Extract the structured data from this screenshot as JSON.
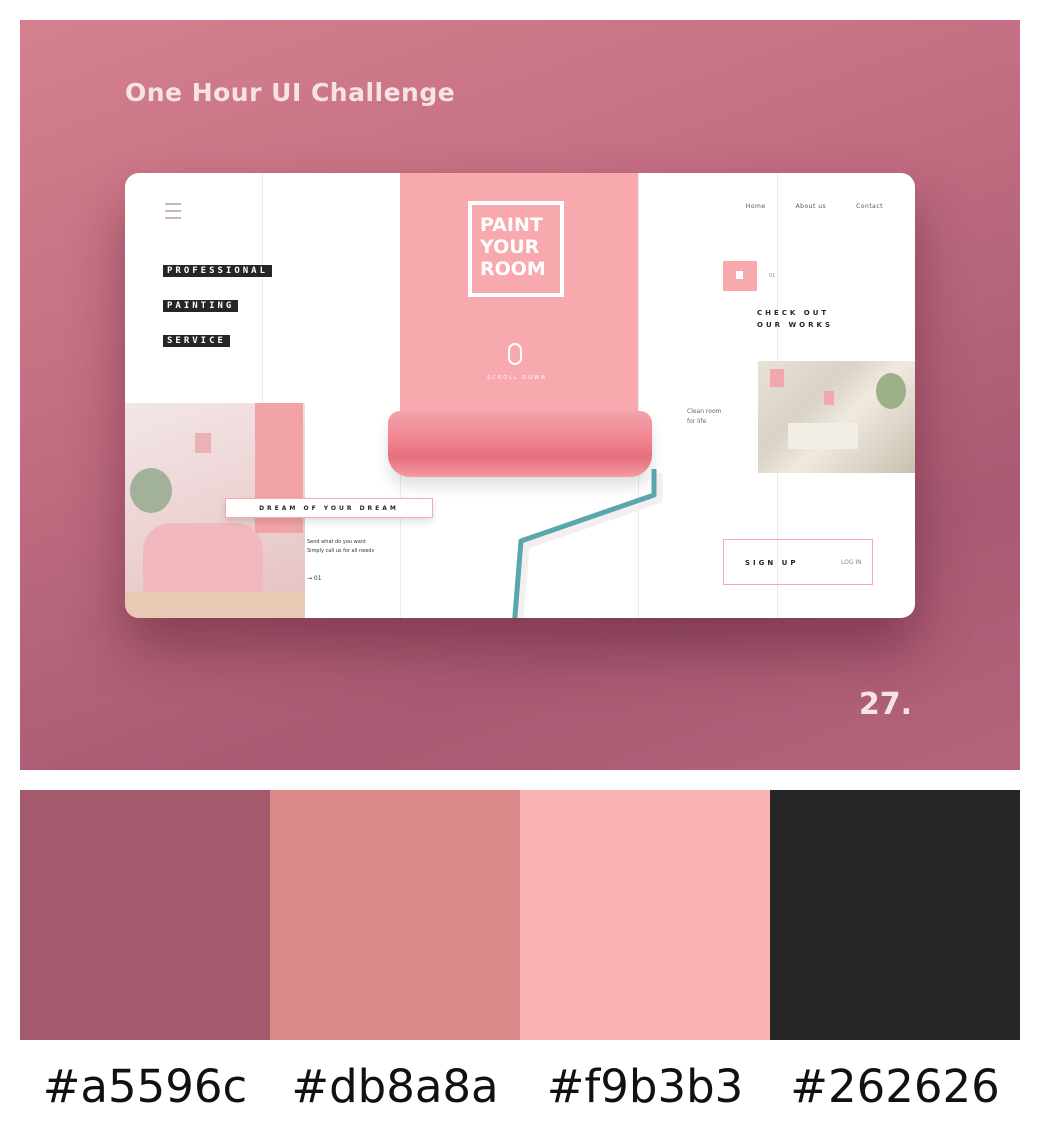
{
  "hero": {
    "title": "One Hour UI Challenge",
    "number": "27."
  },
  "mockup": {
    "headline_lines": [
      "PROFESSIONAL",
      "PAINTING",
      "SERVICE"
    ],
    "logo_lines": [
      "PAINT",
      "YOUR",
      "ROOM"
    ],
    "scroll_label": "SCROLL DOWN",
    "nav": [
      "Home",
      "About us",
      "Contact"
    ],
    "about_tag": "01",
    "about_title_lines": [
      "CHECK OUT",
      "OUR WORKS"
    ],
    "caption_right_lines": [
      "Clean room",
      "for life"
    ],
    "dream_bar": "DREAM OF YOUR DREAM",
    "body_text_lines": [
      "Send what do you want",
      "Simply call us for all needs"
    ],
    "small_link": "→ 01",
    "signup": "SIGN UP",
    "login": "LOG IN"
  },
  "palette": [
    {
      "code": "#a5596c",
      "color": "#a5596c"
    },
    {
      "code": "#db8a8a",
      "color": "#db8a8a"
    },
    {
      "code": "#f9b3b3",
      "color": "#f9b3b3"
    },
    {
      "code": "#262626",
      "color": "#262626"
    }
  ],
  "colors": {
    "accent_pink": "#f7a9ae",
    "teal_handle": "#5aa6ad",
    "dark": "#262626"
  }
}
